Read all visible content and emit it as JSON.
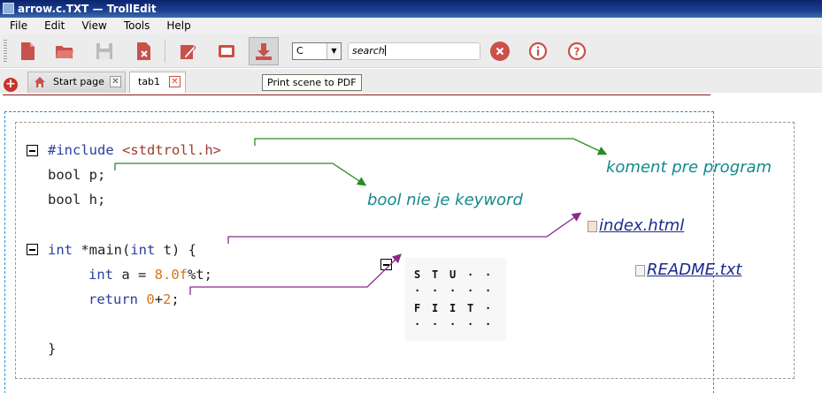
{
  "window": {
    "title": "arrow.c.TXT — TrollEdit"
  },
  "menu": [
    "File",
    "Edit",
    "View",
    "Tools",
    "Help"
  ],
  "toolbar": {
    "buttons": [
      "new-file-icon",
      "open-folder-icon",
      "save-icon",
      "close-file-icon",
      "edit-icon",
      "screen-icon",
      "print-pdf-icon"
    ],
    "language": "C",
    "search_value": "search",
    "tooltip": "Print scene to PDF"
  },
  "tabs": [
    {
      "label": "Start page",
      "active": false
    },
    {
      "label": "tab1",
      "active": true
    }
  ],
  "editor": {
    "lines": {
      "l1_kw": "#include",
      "l1_str": "<stdtroll.h>",
      "l2": "bool p;",
      "l3": "bool h;",
      "l4_kw1": "int",
      "l4_mid": " *main(",
      "l4_kw2": "int",
      "l4_end": " t) {",
      "l5_kw": "int",
      "l5_mid": " a = ",
      "l5_num": "8.0f",
      "l5_end": "%t;",
      "l6_kw": "return",
      "l6_num1": "0",
      "l6_op": "+",
      "l6_num2": "2",
      "l6_end": ";",
      "l7": "}"
    },
    "comments": [
      "koment pre program",
      "bool nie je keyword"
    ],
    "links": [
      "index.html",
      "README.txt"
    ],
    "matrix": [
      [
        "S",
        "T",
        "U",
        "·",
        "·"
      ],
      [
        "·",
        "·",
        "·",
        "·",
        "·"
      ],
      [
        "F",
        "I",
        "I",
        "T",
        "·"
      ],
      [
        "·",
        "·",
        "·",
        "·",
        "·"
      ]
    ],
    "colors": {
      "green_arrow": "#2a8a2a",
      "purple_arrow": "#8a2a8a",
      "comment": "#148a8a"
    }
  }
}
